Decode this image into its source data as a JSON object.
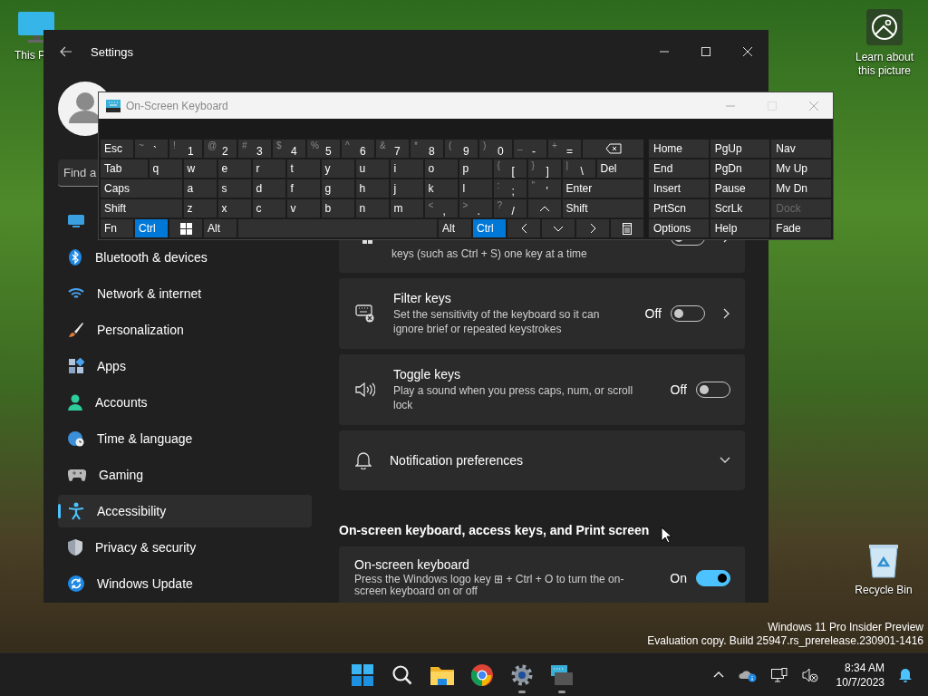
{
  "desktop": {
    "icons": [
      {
        "kind": "computer",
        "label": "This P"
      },
      {
        "kind": "recycle-bin",
        "label": "Recycle Bin"
      }
    ],
    "spotlight": {
      "label": "Learn about this picture"
    },
    "build_info": [
      "Windows 11 Pro Insider Preview",
      "Evaluation copy. Build 25947.rs_prerelease.230901-1416"
    ]
  },
  "settings_window": {
    "title": "Settings",
    "search": {
      "placeholder": "Find a"
    },
    "sidebar": {
      "items": [
        {
          "kind": "system",
          "selected": false
        },
        {
          "kind": "bluetooth",
          "label": "Bluetooth & devices",
          "selected": false
        },
        {
          "kind": "network",
          "label": "Network & internet",
          "selected": false
        },
        {
          "kind": "personalization",
          "label": "Personalization",
          "selected": false
        },
        {
          "kind": "apps",
          "label": "Apps",
          "selected": false
        },
        {
          "kind": "accounts",
          "label": "Accounts",
          "selected": false
        },
        {
          "kind": "time",
          "label": "Time & language",
          "selected": false
        },
        {
          "kind": "gaming",
          "label": "Gaming",
          "selected": false
        },
        {
          "kind": "accessibility",
          "label": "Accessibility",
          "selected": true
        },
        {
          "kind": "privacy",
          "label": "Privacy & security",
          "selected": false
        },
        {
          "kind": "update",
          "label": "Windows Update",
          "selected": false
        }
      ]
    },
    "cards": [
      {
        "kind": "link_toggle",
        "description": "keys (such as Ctrl + S) one key at a time",
        "on": false
      },
      {
        "kind": "link_toggle",
        "title": "Filter keys",
        "description": "Set the sensitivity of the keyboard so it can ignore brief or repeated keystrokes",
        "state_label": "Off",
        "on": false
      },
      {
        "kind": "toggle",
        "title": "Toggle keys",
        "description": "Play a sound when you press caps, num, or scroll lock",
        "state_label": "Off",
        "on": false
      },
      {
        "kind": "expander",
        "title": "Notification preferences",
        "expanded": false
      }
    ],
    "section_heading": "On-screen keyboard, access keys, and Print screen",
    "section_cards": [
      {
        "kind": "toggle",
        "title": "On-screen keyboard",
        "description": "Press the Windows logo key ⊞ + Ctrl + O to turn the on-screen keyboard on or off",
        "state_label": "On",
        "on": true
      }
    ]
  },
  "keyboard_window": {
    "title": "On-Screen Keyboard",
    "rows": [
      {
        "keys": [
          {
            "kind": "key",
            "label": "Esc",
            "on": false
          },
          {
            "kind": "dual",
            "top": "~",
            "label": "`",
            "on": false
          },
          {
            "kind": "dual",
            "top": "!",
            "label": "1",
            "on": false
          },
          {
            "kind": "dual",
            "top": "@",
            "label": "2",
            "on": false
          },
          {
            "kind": "dual",
            "top": "#",
            "label": "3",
            "on": false
          },
          {
            "kind": "dual",
            "top": "$",
            "label": "4",
            "on": false
          },
          {
            "kind": "dual",
            "top": "%",
            "label": "5",
            "on": false
          },
          {
            "kind": "dual",
            "top": "^",
            "label": "6",
            "on": false
          },
          {
            "kind": "dual",
            "top": "&",
            "label": "7",
            "on": false
          },
          {
            "kind": "dual",
            "top": "*",
            "label": "8",
            "on": false
          },
          {
            "kind": "dual",
            "top": "(",
            "label": "9",
            "on": false
          },
          {
            "kind": "dual",
            "top": ")",
            "label": "0",
            "on": false
          },
          {
            "kind": "dual",
            "top": "_",
            "label": "-",
            "on": false
          },
          {
            "kind": "dual",
            "top": "+",
            "label": "=",
            "on": false
          },
          {
            "kind": "backspace",
            "on": false
          }
        ]
      },
      {
        "keys": [
          {
            "kind": "wide",
            "label": "Tab",
            "on": false
          },
          {
            "kind": "key",
            "label": "q",
            "on": false
          },
          {
            "kind": "key",
            "label": "w",
            "on": false
          },
          {
            "kind": "key",
            "label": "e",
            "on": false
          },
          {
            "kind": "key",
            "label": "r",
            "on": false
          },
          {
            "kind": "key",
            "label": "t",
            "on": false
          },
          {
            "kind": "key",
            "label": "y",
            "on": false
          },
          {
            "kind": "key",
            "label": "u",
            "on": false
          },
          {
            "kind": "key",
            "label": "i",
            "on": false
          },
          {
            "kind": "key",
            "label": "o",
            "on": false
          },
          {
            "kind": "key",
            "label": "p",
            "on": false
          },
          {
            "kind": "dual",
            "top": "{",
            "label": "[",
            "on": false
          },
          {
            "kind": "dual",
            "top": "}",
            "label": "]",
            "on": false
          },
          {
            "kind": "dual",
            "top": "|",
            "label": "\\",
            "on": false
          },
          {
            "kind": "wide",
            "label": "Del",
            "on": false
          }
        ]
      },
      {
        "keys": [
          {
            "kind": "wide",
            "label": "Caps",
            "on": false
          },
          {
            "kind": "key",
            "label": "a",
            "on": false
          },
          {
            "kind": "key",
            "label": "s",
            "on": false
          },
          {
            "kind": "key",
            "label": "d",
            "on": false
          },
          {
            "kind": "key",
            "label": "f",
            "on": false
          },
          {
            "kind": "key",
            "label": "g",
            "on": false
          },
          {
            "kind": "key",
            "label": "h",
            "on": false
          },
          {
            "kind": "key",
            "label": "j",
            "on": false
          },
          {
            "kind": "key",
            "label": "k",
            "on": false
          },
          {
            "kind": "key",
            "label": "l",
            "on": false
          },
          {
            "kind": "dual",
            "top": ":",
            "label": ";",
            "on": false
          },
          {
            "kind": "dual",
            "top": "\"",
            "label": "'",
            "on": false
          },
          {
            "kind": "wide",
            "label": "Enter",
            "on": false
          }
        ]
      },
      {
        "keys": [
          {
            "kind": "wide",
            "label": "Shift",
            "on": false
          },
          {
            "kind": "key",
            "label": "z",
            "on": false
          },
          {
            "kind": "key",
            "label": "x",
            "on": false
          },
          {
            "kind": "key",
            "label": "c",
            "on": false
          },
          {
            "kind": "key",
            "label": "v",
            "on": false
          },
          {
            "kind": "key",
            "label": "b",
            "on": false
          },
          {
            "kind": "key",
            "label": "n",
            "on": false
          },
          {
            "kind": "key",
            "label": "m",
            "on": false
          },
          {
            "kind": "dual",
            "top": "<",
            "label": ",",
            "on": false
          },
          {
            "kind": "dual",
            "top": ">",
            "label": ".",
            "on": false
          },
          {
            "kind": "dual",
            "top": "?",
            "label": "/",
            "on": false
          },
          {
            "kind": "up",
            "on": false
          },
          {
            "kind": "wide",
            "label": "Shift",
            "on": false
          }
        ]
      },
      {
        "keys": [
          {
            "kind": "key",
            "label": "Fn",
            "on": false
          },
          {
            "kind": "key",
            "label": "Ctrl",
            "on": true
          },
          {
            "kind": "windows",
            "on": false
          },
          {
            "kind": "key",
            "label": "Alt",
            "on": false
          },
          {
            "kind": "space",
            "on": false
          },
          {
            "kind": "key",
            "label": "Alt",
            "on": false
          },
          {
            "kind": "key",
            "label": "Ctrl",
            "on": true
          },
          {
            "kind": "left",
            "on": false
          },
          {
            "kind": "down",
            "on": false
          },
          {
            "kind": "right",
            "on": false
          },
          {
            "kind": "menu",
            "on": false
          }
        ]
      }
    ],
    "nav_rows": [
      {
        "keys": [
          {
            "label": "Home",
            "disabled": false
          },
          {
            "label": "PgUp",
            "disabled": false
          },
          {
            "label": "Nav",
            "disabled": false
          }
        ]
      },
      {
        "keys": [
          {
            "label": "End",
            "disabled": false
          },
          {
            "label": "PgDn",
            "disabled": false
          },
          {
            "label": "Mv Up",
            "disabled": false
          }
        ]
      },
      {
        "keys": [
          {
            "label": "Insert",
            "disabled": false
          },
          {
            "label": "Pause",
            "disabled": false
          },
          {
            "label": "Mv Dn",
            "disabled": false
          }
        ]
      },
      {
        "keys": [
          {
            "label": "PrtScn",
            "disabled": false
          },
          {
            "label": "ScrLk",
            "disabled": false
          },
          {
            "label": "Dock",
            "disabled": true
          }
        ]
      },
      {
        "keys": [
          {
            "label": "Options",
            "disabled": false
          },
          {
            "label": "Help",
            "disabled": false
          },
          {
            "label": "Fade",
            "disabled": false
          }
        ]
      }
    ]
  },
  "taskbar": {
    "apps": [
      {
        "kind": "start",
        "running": false
      },
      {
        "kind": "search",
        "running": false
      },
      {
        "kind": "explorer",
        "running": false
      },
      {
        "kind": "browser",
        "running": false
      },
      {
        "kind": "settings",
        "running": true
      },
      {
        "kind": "keyboard",
        "running": true
      }
    ],
    "clock": {
      "time": "8:34 AM",
      "date": "10/7/2023"
    }
  }
}
